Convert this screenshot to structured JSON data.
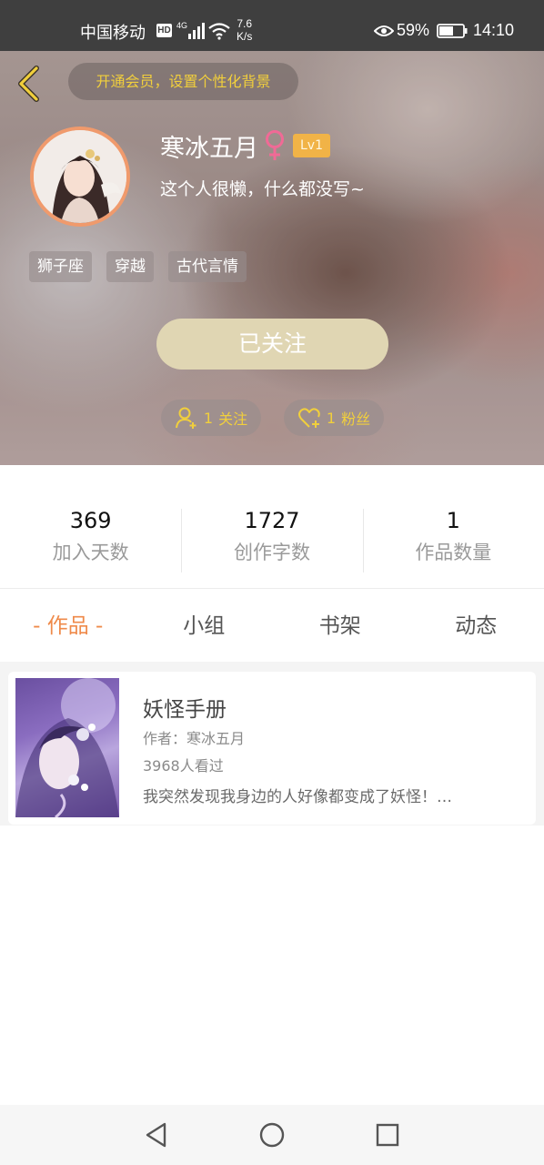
{
  "status_bar": {
    "carrier": "中国移动",
    "hd": "HD",
    "network": "4G",
    "speed_value": "7.6",
    "speed_unit": "K/s",
    "battery": "59%",
    "time": "14:10",
    "icons": [
      "hd-icon",
      "signal-icon",
      "wifi-icon",
      "eye-icon",
      "battery-icon"
    ]
  },
  "header": {
    "vip_banner": "开通会员，设置个性化背景",
    "nickname": "寒冰五月",
    "gender": "female",
    "level": "Lv1",
    "bio": "这个人很懒，什么都没写~",
    "tags": [
      "狮子座",
      "穿越",
      "古代言情"
    ],
    "follow_button": "已关注",
    "following_count": "1",
    "following_label": "关注",
    "fans_count": "1",
    "fans_label": "粉丝",
    "colors": {
      "accent": "#f1cf3c",
      "avatar_ring": "#f09a6c",
      "follow_btn": "#e0d6b3",
      "level_badge": "#f1b347"
    }
  },
  "stats": [
    {
      "value": "369",
      "label": "加入天数"
    },
    {
      "value": "1727",
      "label": "创作字数"
    },
    {
      "value": "1",
      "label": "作品数量"
    }
  ],
  "tabs": {
    "items": [
      "- 作品 -",
      "小组",
      "书架",
      "动态"
    ],
    "active_index": 0,
    "active_color": "#ef8a4a"
  },
  "works": [
    {
      "title": "妖怪手册",
      "author": "作者：寒冰五月",
      "views": "3968人看过",
      "description": "我突然发现我身边的人好像都变成了妖怪！…"
    }
  ],
  "nav_bar": {
    "icons": [
      "back-triangle-icon",
      "home-circle-icon",
      "recents-square-icon"
    ]
  }
}
